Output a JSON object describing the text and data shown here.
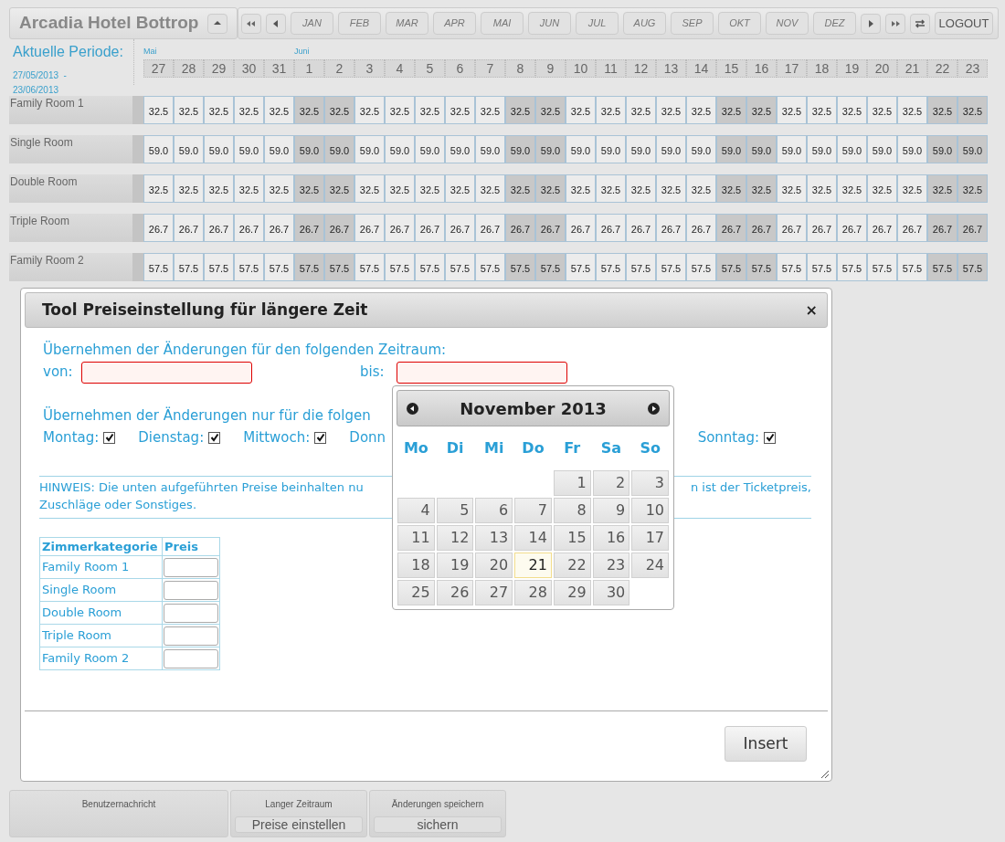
{
  "header": {
    "hotel_name": "Arcadia Hotel Bottrop",
    "months": [
      {
        "label": "JAN"
      },
      {
        "label": "FEB"
      },
      {
        "label": "MAR"
      },
      {
        "label": "APR"
      },
      {
        "label": "MAI"
      },
      {
        "label": "JUN"
      },
      {
        "label": "JUL"
      },
      {
        "label": "AUG"
      },
      {
        "label": "SEP"
      },
      {
        "label": "OKT"
      },
      {
        "label": "NOV"
      },
      {
        "label": "DEZ"
      }
    ],
    "logout": "LOGOUT"
  },
  "period": {
    "label": "Aktuelle Periode:",
    "start": "27/05/2013  -",
    "end": "23/06/2013"
  },
  "calendar": [
    {
      "month": "Mai",
      "days": [
        {
          "label": "27",
          "weekend": false
        },
        {
          "label": "28",
          "weekend": false
        },
        {
          "label": "29",
          "weekend": false
        },
        {
          "label": "30",
          "weekend": false
        },
        {
          "label": "31",
          "weekend": false
        }
      ]
    },
    {
      "month": "Juni",
      "days": [
        {
          "label": "1",
          "weekend": true
        },
        {
          "label": "2",
          "weekend": true
        },
        {
          "label": "3",
          "weekend": false
        },
        {
          "label": "4",
          "weekend": false
        },
        {
          "label": "5",
          "weekend": false
        },
        {
          "label": "6",
          "weekend": false
        },
        {
          "label": "7",
          "weekend": false
        },
        {
          "label": "8",
          "weekend": true
        },
        {
          "label": "9",
          "weekend": true
        },
        {
          "label": "10",
          "weekend": false
        },
        {
          "label": "11",
          "weekend": false
        },
        {
          "label": "12",
          "weekend": false
        },
        {
          "label": "13",
          "weekend": false
        },
        {
          "label": "14",
          "weekend": false
        },
        {
          "label": "15",
          "weekend": true
        },
        {
          "label": "16",
          "weekend": true
        },
        {
          "label": "17",
          "weekend": false
        },
        {
          "label": "18",
          "weekend": false
        },
        {
          "label": "19",
          "weekend": false
        },
        {
          "label": "20",
          "weekend": false
        },
        {
          "label": "21",
          "weekend": false
        },
        {
          "label": "22",
          "weekend": true
        },
        {
          "label": "23",
          "weekend": true
        }
      ]
    }
  ],
  "rooms": [
    {
      "name": "Family Room 1",
      "prices": [
        "32.5",
        "32.5",
        "32.5",
        "32.5",
        "32.5",
        "32.5",
        "32.5",
        "32.5",
        "32.5",
        "32.5",
        "32.5",
        "32.5",
        "32.5",
        "32.5",
        "32.5",
        "32.5",
        "32.5",
        "32.5",
        "32.5",
        "32.5",
        "32.5",
        "32.5",
        "32.5",
        "32.5",
        "32.5",
        "32.5",
        "32.5",
        "32.5"
      ]
    },
    {
      "name": "Single Room",
      "prices": [
        "59.0",
        "59.0",
        "59.0",
        "59.0",
        "59.0",
        "59.0",
        "59.0",
        "59.0",
        "59.0",
        "59.0",
        "59.0",
        "59.0",
        "59.0",
        "59.0",
        "59.0",
        "59.0",
        "59.0",
        "59.0",
        "59.0",
        "59.0",
        "59.0",
        "59.0",
        "59.0",
        "59.0",
        "59.0",
        "59.0",
        "59.0",
        "59.0"
      ]
    },
    {
      "name": "Double Room",
      "prices": [
        "32.5",
        "32.5",
        "32.5",
        "32.5",
        "32.5",
        "32.5",
        "32.5",
        "32.5",
        "32.5",
        "32.5",
        "32.5",
        "32.5",
        "32.5",
        "32.5",
        "32.5",
        "32.5",
        "32.5",
        "32.5",
        "32.5",
        "32.5",
        "32.5",
        "32.5",
        "32.5",
        "32.5",
        "32.5",
        "32.5",
        "32.5",
        "32.5"
      ]
    },
    {
      "name": "Triple Room",
      "prices": [
        "26.7",
        "26.7",
        "26.7",
        "26.7",
        "26.7",
        "26.7",
        "26.7",
        "26.7",
        "26.7",
        "26.7",
        "26.7",
        "26.7",
        "26.7",
        "26.7",
        "26.7",
        "26.7",
        "26.7",
        "26.7",
        "26.7",
        "26.7",
        "26.7",
        "26.7",
        "26.7",
        "26.7",
        "26.7",
        "26.7",
        "26.7",
        "26.7"
      ]
    },
    {
      "name": "Family Room 2",
      "prices": [
        "57.5",
        "57.5",
        "57.5",
        "57.5",
        "57.5",
        "57.5",
        "57.5",
        "57.5",
        "57.5",
        "57.5",
        "57.5",
        "57.5",
        "57.5",
        "57.5",
        "57.5",
        "57.5",
        "57.5",
        "57.5",
        "57.5",
        "57.5",
        "57.5",
        "57.5",
        "57.5",
        "57.5",
        "57.5",
        "57.5",
        "57.5",
        "57.5"
      ]
    }
  ],
  "dialog": {
    "title": "Tool Preiseinstellung für längere Zeit",
    "close": "×",
    "range_heading": "Übernehmen der Änderungen für den folgenden Zeitraum:",
    "from_label": "von:",
    "to_label": "bis:",
    "weekday_heading": "Übernehmen der Änderungen nur für die folgen",
    "weekdays": [
      {
        "kind": "checkbox",
        "label": "Montag:",
        "checked": true
      },
      {
        "kind": "checkbox",
        "label": "Dienstag:",
        "checked": true
      },
      {
        "kind": "checkbox",
        "label": "Mittwoch:",
        "checked": true
      },
      {
        "kind": "cut",
        "label": "Donn"
      },
      {
        "kind": "checkbox",
        "label": "Sonntag:",
        "checked": true
      }
    ],
    "hint_left": "HINWEIS: Die unten aufgeführten Preise beinhalten nu",
    "hint_right": "n ist der Ticketpreis,",
    "hint_line2": "Zuschläge oder Sonstiges.",
    "price_table": {
      "columns": [
        "Zimmerkategorie",
        "Preis"
      ],
      "rows": [
        {
          "category": "Family Room 1"
        },
        {
          "category": "Single Room"
        },
        {
          "category": "Double Room"
        },
        {
          "category": "Triple Room"
        },
        {
          "category": "Family Room 2"
        }
      ]
    },
    "insert_button": "Insert"
  },
  "datepicker": {
    "title": "November 2013",
    "weekdays": [
      "Mo",
      "Di",
      "Mi",
      "Do",
      "Fr",
      "Sa",
      "So"
    ],
    "weeks": [
      [
        {
          "label": "1",
          "today": false
        },
        {
          "label": "2",
          "today": false
        },
        {
          "label": "3",
          "today": false
        }
      ],
      [
        {
          "label": "4",
          "today": false
        },
        {
          "label": "5",
          "today": false
        },
        {
          "label": "6",
          "today": false
        },
        {
          "label": "7",
          "today": false
        },
        {
          "label": "8",
          "today": false
        },
        {
          "label": "9",
          "today": false
        },
        {
          "label": "10",
          "today": false
        }
      ],
      [
        {
          "label": "11",
          "today": false
        },
        {
          "label": "12",
          "today": false
        },
        {
          "label": "13",
          "today": false
        },
        {
          "label": "14",
          "today": false
        },
        {
          "label": "15",
          "today": false
        },
        {
          "label": "16",
          "today": false
        },
        {
          "label": "17",
          "today": false
        }
      ],
      [
        {
          "label": "18",
          "today": false
        },
        {
          "label": "19",
          "today": false
        },
        {
          "label": "20",
          "today": false
        },
        {
          "label": "21",
          "today": true
        },
        {
          "label": "22",
          "today": false
        },
        {
          "label": "23",
          "today": false
        },
        {
          "label": "24",
          "today": false
        }
      ],
      [
        {
          "label": "25",
          "today": false
        },
        {
          "label": "26",
          "today": false
        },
        {
          "label": "27",
          "today": false
        },
        {
          "label": "28",
          "today": false
        },
        {
          "label": "29",
          "today": false
        },
        {
          "label": "30",
          "today": false
        }
      ]
    ]
  },
  "footer": [
    {
      "label": "Benutzernachricht"
    },
    {
      "label": "Langer Zeitraum",
      "button": "Preise einstellen"
    },
    {
      "label": "Änderungen speichern",
      "button": "sichern"
    }
  ]
}
